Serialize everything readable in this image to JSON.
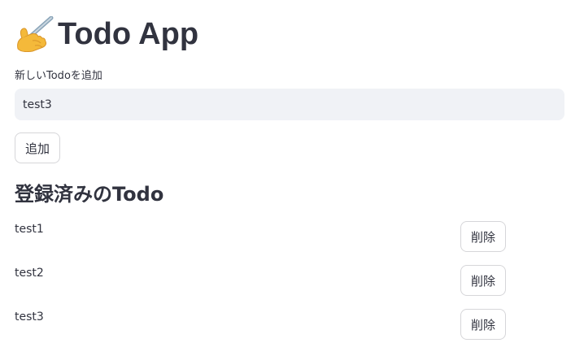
{
  "header": {
    "title": "Todo App",
    "icon": "writing-hand-icon"
  },
  "add_form": {
    "label": "新しいTodoを追加",
    "value": "test3",
    "button_label": "追加"
  },
  "todo_list": {
    "heading": "登録済みのTodo",
    "items": [
      {
        "text": "test1",
        "delete_label": "削除"
      },
      {
        "text": "test2",
        "delete_label": "削除"
      },
      {
        "text": "test3",
        "delete_label": "削除"
      }
    ]
  },
  "colors": {
    "text": "#31333f",
    "input_background": "#f0f2f6",
    "background": "#ffffff"
  }
}
